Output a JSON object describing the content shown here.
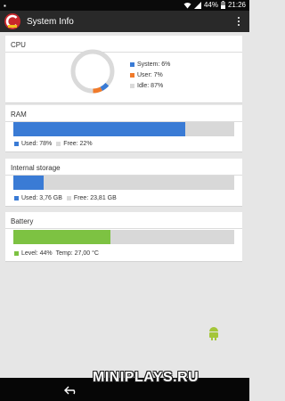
{
  "status_bar": {
    "battery_text": "44%",
    "time": "21:26"
  },
  "app_bar": {
    "title": "System Info"
  },
  "cpu": {
    "title": "CPU",
    "system_pct": 6,
    "user_pct": 7,
    "idle_pct": 87,
    "legend": [
      "System: 6%",
      "User: 7%",
      "Idle: 87%"
    ],
    "colors": {
      "system": "#3a7bd5",
      "user": "#f07a2a",
      "idle": "#dadada"
    }
  },
  "ram": {
    "title": "RAM",
    "used_pct": 78,
    "used_label": "Used: 78%",
    "free_label": "Free: 22%",
    "color": "#3a7bd5"
  },
  "storage": {
    "title": "Internal storage",
    "used_fraction": 0.136,
    "used_label": "Used: 3,76 GB",
    "free_label": "Free: 23,81 GB",
    "color": "#3a7bd5"
  },
  "battery": {
    "title": "Battery",
    "level_pct": 44,
    "level_label": "Level: 44%",
    "temp_label": "Temp: 27,00 °C",
    "color": "#7dc242"
  },
  "watermark": {
    "text": "MINIPLAYS.RU"
  }
}
